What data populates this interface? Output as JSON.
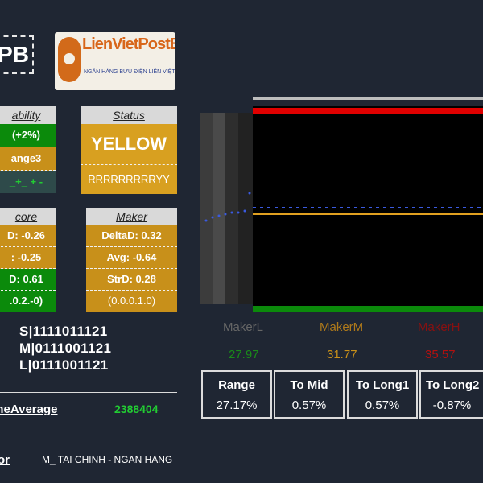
{
  "ticker": "PB",
  "logo": {
    "name": "LienVietPostBank",
    "tagline": "NGÂN HÀNG BƯU ĐIỆN LIÊN VIỆT"
  },
  "stability": {
    "title": "ability",
    "row1": "(+2%)",
    "row2": "ange3",
    "row3": "_+_ + -"
  },
  "status": {
    "title": "Status",
    "value": "YELLOW",
    "code": "RRRRRRRRRYY"
  },
  "score": {
    "title": "core",
    "delta": "D: -0.26",
    "avg": ": -0.25",
    "std": "D: 0.61",
    "vec": ".0.2.-0)"
  },
  "maker": {
    "title": "Maker",
    "delta": "DeltaD: 0.32",
    "avg": "Avg: -0.64",
    "std": "StrD: 0.28",
    "vec": "(0.0.0.1.0)"
  },
  "signals": {
    "s": "S|1111011121",
    "m": "M|0111001121",
    "l": "L|0111001121"
  },
  "volume": {
    "label": "umeAverage",
    "value": "2388404"
  },
  "sector": {
    "label": "tor",
    "value": "M_ TAI CHINH - NGAN HANG"
  },
  "makers": {
    "low": {
      "label": "MakerL",
      "value": "27.97"
    },
    "mid": {
      "label": "MakerM",
      "value": "31.77"
    },
    "high": {
      "label": "MakerH",
      "value": "35.57"
    }
  },
  "stats": [
    {
      "label": "Range",
      "value": "27.17%"
    },
    {
      "label": "To Mid",
      "value": "0.57%"
    },
    {
      "label": "To Long1",
      "value": "0.57%"
    },
    {
      "label": "To Long2",
      "value": "-0.87%"
    }
  ],
  "colors": {
    "green": "#0b8a0b",
    "gold": "#c8901a",
    "red": "#e00000",
    "blue": "#3a5ae0"
  }
}
